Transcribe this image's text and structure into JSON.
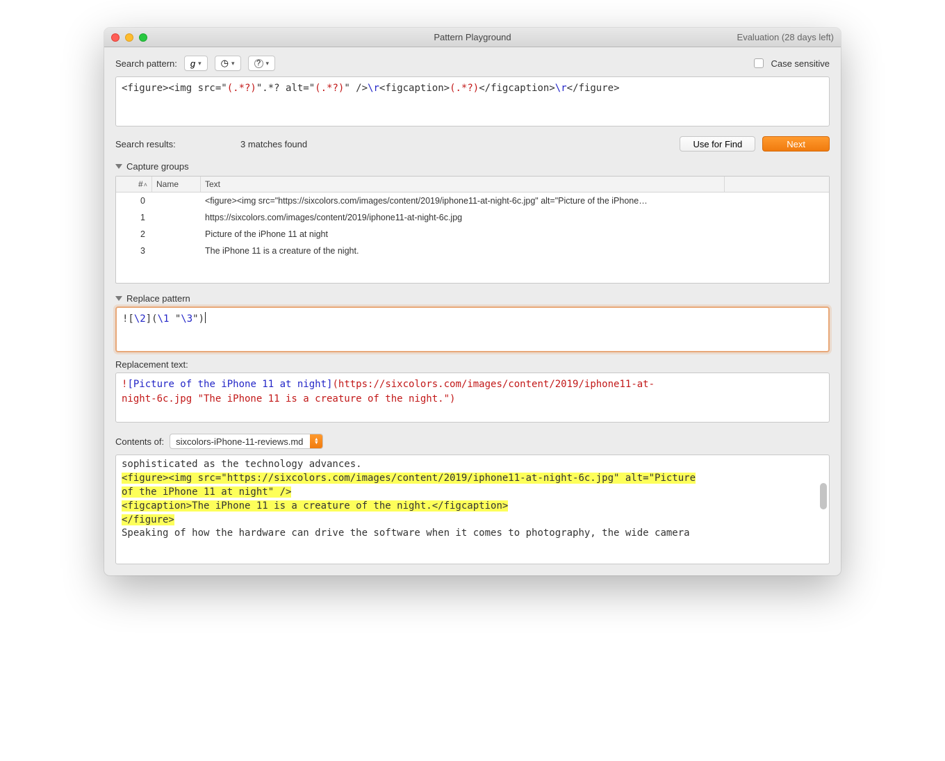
{
  "window": {
    "title": "Pattern Playground",
    "evaluation_text": "Evaluation (28 days left)"
  },
  "search_row": {
    "label": "Search pattern:",
    "grep_btn": "g",
    "case_sensitive_label": "Case sensitive"
  },
  "search_pattern": {
    "p1": "<figure><img src=\"",
    "g1": "(.*?)",
    "p2": "\".*? alt=\"",
    "g2": "(.*?)",
    "p3": "\" />",
    "esc1": "\\r",
    "p4": "<figcaption>",
    "g3": "(.*?)",
    "p5": "</figcaption>",
    "esc2": "\\r",
    "p6": "</figure>"
  },
  "results": {
    "label": "Search results:",
    "text": "3 matches found",
    "use_for_find": "Use for Find",
    "next": "Next"
  },
  "capture": {
    "header": "Capture groups",
    "cols": {
      "num": "#",
      "name": "Name",
      "text": "Text"
    },
    "rows": [
      {
        "n": "0",
        "name": "",
        "text": "<figure><img src=\"https://sixcolors.com/images/content/2019/iphone11-at-night-6c.jpg\" alt=\"Picture of the iPhone…"
      },
      {
        "n": "1",
        "name": "",
        "text": "https://sixcolors.com/images/content/2019/iphone11-at-night-6c.jpg"
      },
      {
        "n": "2",
        "name": "",
        "text": "Picture of the iPhone 11 at night"
      },
      {
        "n": "3",
        "name": "",
        "text": "The iPhone 11 is a creature of the night."
      }
    ]
  },
  "replace": {
    "header": "Replace pattern",
    "p1": "![",
    "b1": "\\2",
    "p2": "](",
    "b2": "\\1",
    "p3": " \"",
    "b3": "\\3",
    "p4": "\")"
  },
  "replacement": {
    "label": "Replacement text:",
    "t1": "!",
    "t2": "[Picture of the iPhone 11 at night]",
    "t3": "(",
    "t4a": "https://sixcolors.com/images/content/2019/iphone11-at-",
    "t4b": "night-6c.jpg \"The iPhone 11 is a creature of the night.\"",
    "t5": ")"
  },
  "contents": {
    "label": "Contents of:",
    "selected": "sixcolors-iPhone-11-reviews.md"
  },
  "source": {
    "line1": "sophisticated as the technology advances.",
    "blank": "",
    "hl1": "<figure><img src=\"https://sixcolors.com/images/content/2019/iphone11-at-night-6c.jpg\" alt=\"Picture",
    "hl2": "of the iPhone 11 at night\" />",
    "hl3": "<figcaption>The iPhone 11 is a creature of the night.</figcaption>",
    "hl4": "</figure>",
    "after": "Speaking of how the hardware can drive the software when it comes to photography, the wide camera"
  }
}
